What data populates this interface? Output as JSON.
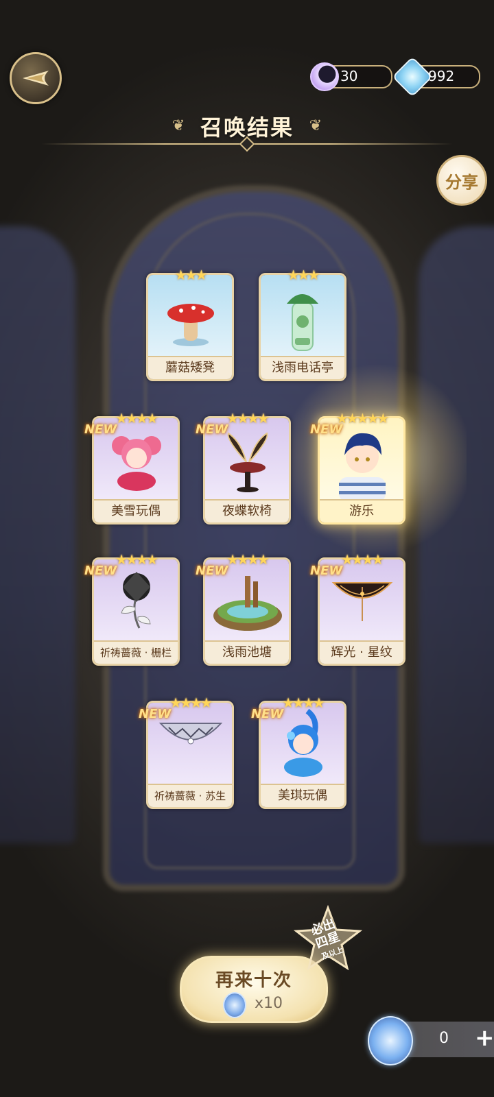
{
  "header": {
    "title": "召唤结果",
    "moon_currency": "30",
    "gem_currency": "992",
    "share_label": "分享"
  },
  "cards": [
    {
      "name": "蘑菇矮凳",
      "stars": "★★★",
      "new": "",
      "rarity": 3
    },
    {
      "name": "浅雨电话亭",
      "stars": "★★★",
      "new": "",
      "rarity": 3
    },
    {
      "name": "美雪玩偶",
      "stars": "★★★★",
      "new": "NEW",
      "rarity": 4
    },
    {
      "name": "夜蝶软椅",
      "stars": "★★★★",
      "new": "NEW",
      "rarity": 4
    },
    {
      "name": "游乐",
      "stars": "★★★★★",
      "new": "NEW",
      "rarity": 5
    },
    {
      "name": "祈祷蔷薇 · 栅栏",
      "stars": "★★★★",
      "new": "NEW",
      "rarity": 4
    },
    {
      "name": "浅雨池塘",
      "stars": "★★★★",
      "new": "NEW",
      "rarity": 4
    },
    {
      "name": "辉光 · 星纹",
      "stars": "★★★★",
      "new": "NEW",
      "rarity": 4
    },
    {
      "name": "祈祷蔷薇 · 苏生",
      "stars": "★★★★",
      "new": "NEW",
      "rarity": 4
    },
    {
      "name": "美琪玩偶",
      "stars": "★★★★",
      "new": "NEW",
      "rarity": 4
    }
  ],
  "footer": {
    "again_label": "再来十次",
    "again_cost": "x10",
    "guarantee_line1": "必出",
    "guarantee_line2": "四星",
    "guarantee_line3": "及以上",
    "ticket_count": "0",
    "plus": "+"
  }
}
